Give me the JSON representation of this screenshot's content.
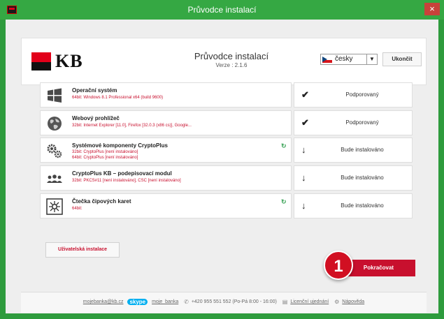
{
  "window": {
    "title": "Průvodce instalací",
    "close_symbol": "×"
  },
  "header": {
    "logo_text": "KB",
    "title": "Průvodce instalací",
    "version": "Verze : 2.1.6",
    "language": "česky",
    "end_button": "Ukončit"
  },
  "rows": [
    {
      "title": "Operační systém",
      "details": [
        "64bit: Windows 8.1 Professional x64 (build 9600)"
      ],
      "status_icon": "checkmark-icon",
      "status": "Podporovaný"
    },
    {
      "title": "Webový prohlížeč",
      "details": [
        "32bit: Internet Explorer [11.0], Firefox [32.0.3 (x86 cs)], Google..."
      ],
      "status_icon": "checkmark-icon",
      "status": "Podporovaný"
    },
    {
      "title": "Systémové komponenty CryptoPlus",
      "details": [
        "32bit: CryptoPlus [není instalováno]",
        "64bit: CryptoPlus [není instalováno]"
      ],
      "status_icon": "download-arrow-icon",
      "status": "Bude instalováno"
    },
    {
      "title": "CryptoPlus KB – podepisovací modul",
      "details": [
        "32bit: PKCS#11 [není instalováno], CSC [není instalováno]"
      ],
      "status_icon": "download-arrow-icon",
      "status": "Bude instalováno"
    },
    {
      "title": "Čtečka čipových karet",
      "details": [
        "64bit:"
      ],
      "status_icon": "download-arrow-icon",
      "status": "Bude instalováno"
    }
  ],
  "actions": {
    "custom_install": "Uživatelská instalace",
    "badge": "1",
    "continue": "Pokračovat"
  },
  "footer": {
    "email": "mojebanka@kb.cz",
    "skype_logo": "skype",
    "skype_name": "moje_banka",
    "phone": "+420 955 551 552 (Po-Pá 8:00 - 16:00)",
    "license": "Licenční ujednání",
    "help": "Nápověda"
  },
  "colors": {
    "window_frame": "#2e9b3d",
    "kb_red": "#e2001a",
    "button_red": "#c8102e"
  }
}
